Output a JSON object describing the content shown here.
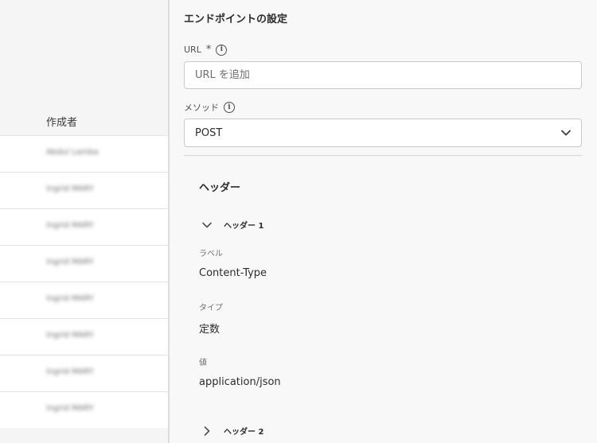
{
  "table": {
    "column_header": "作成者",
    "rows": [
      "Abdul Lamba",
      "Ingrid MARY",
      "Ingrid MARY",
      "Ingrid MARY",
      "Ingrid MARY",
      "Ingrid MARY",
      "Ingrid MARY",
      "Ingrid MARY"
    ]
  },
  "panel": {
    "title": "エンドポイントの設定",
    "url_label": "URL",
    "url_required": "*",
    "url_placeholder": "URL を追加",
    "method_label": "メソッド",
    "method_value": "POST",
    "headers_title": "ヘッダー",
    "header1": {
      "toggle_label": "ヘッダー 1",
      "label_caption": "ラベル",
      "label_value": "Content-Type",
      "type_caption": "タイプ",
      "type_value": "定数",
      "value_caption": "値",
      "value_value": "application/json"
    },
    "header2": {
      "toggle_label": "ヘッダー 2"
    }
  },
  "icons": {
    "info": "info-icon",
    "chevron_down": "chevron-down-icon",
    "chevron_right": "chevron-right-icon"
  }
}
